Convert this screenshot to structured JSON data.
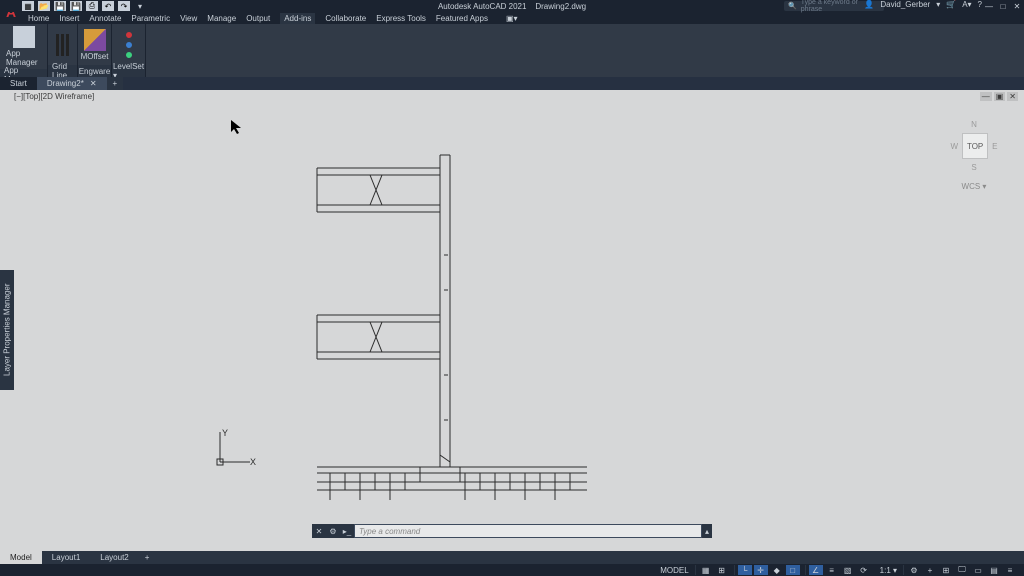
{
  "app": {
    "title_prefix": "Autodesk AutoCAD 2021",
    "document": "Drawing2.dwg",
    "username": "David_Gerber",
    "search_placeholder": "Type a keyword or phrase"
  },
  "menu": {
    "items": [
      "Home",
      "Insert",
      "Annotate",
      "Parametric",
      "View",
      "Manage",
      "Output",
      "Add-ins",
      "Collaborate",
      "Express Tools",
      "Featured Apps"
    ],
    "active": "Add-ins"
  },
  "ribbon": {
    "panels": [
      {
        "title": "App Manager",
        "buttons": [
          {
            "label": "App Manager"
          }
        ]
      },
      {
        "title": "Grid Line",
        "buttons": [
          {
            "label": ""
          }
        ]
      },
      {
        "title": "Engware",
        "buttons": [
          {
            "label": "MOffset"
          }
        ]
      },
      {
        "title": "LevelSet ▾",
        "buttons": []
      }
    ]
  },
  "filetabs": {
    "start": "Start",
    "tabs": [
      {
        "label": "Drawing2*",
        "active": true
      }
    ]
  },
  "viewport": {
    "label": "[−][Top][2D Wireframe]",
    "axes": {
      "x": "X",
      "y": "Y"
    }
  },
  "palette": {
    "label": "Layer Properties Manager"
  },
  "viewcube": {
    "face": "TOP",
    "n": "N",
    "s": "S",
    "e": "E",
    "w": "W",
    "wcs": "WCS ▾"
  },
  "cmd": {
    "placeholder": "Type a command"
  },
  "layouts": {
    "items": [
      "Model",
      "Layout1",
      "Layout2"
    ],
    "active": "Model"
  },
  "status": {
    "model": "MODEL",
    "scale": "1:1 ▾"
  }
}
